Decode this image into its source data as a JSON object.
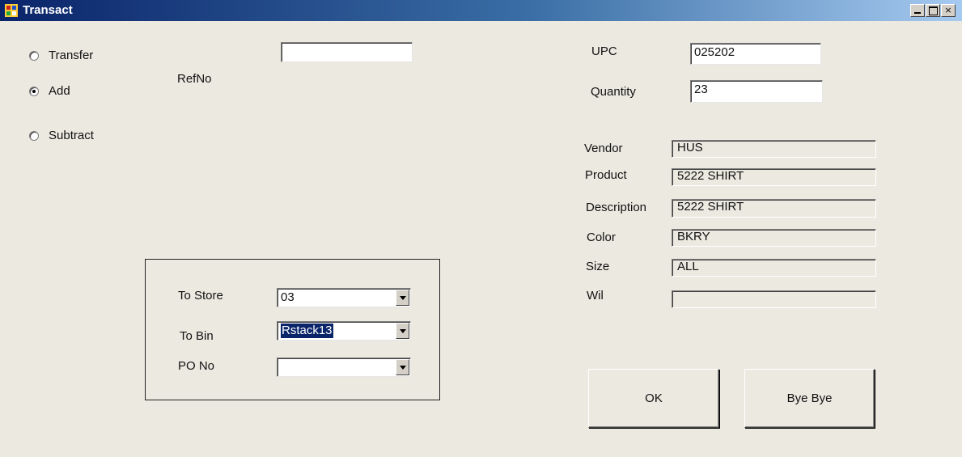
{
  "window": {
    "title": "Transact",
    "min_glyph": "",
    "max_glyph": "",
    "close_glyph": "×"
  },
  "mode": {
    "options": [
      {
        "label": "Transfer",
        "checked": false
      },
      {
        "label": "Add",
        "checked": true
      },
      {
        "label": "Subtract",
        "checked": false
      }
    ]
  },
  "refno": {
    "label": "RefNo",
    "value": ""
  },
  "upc": {
    "label": "UPC",
    "value": "025202"
  },
  "quantity": {
    "label": "Quantity",
    "value": "23"
  },
  "details": [
    {
      "label": "Vendor",
      "value": "HUS"
    },
    {
      "label": "Product",
      "value": "5222 SHIRT"
    },
    {
      "label": "Description",
      "value": "5222 SHIRT"
    },
    {
      "label": "Color",
      "value": "BKRY"
    },
    {
      "label": "Size",
      "value": "ALL"
    },
    {
      "label": "Wil",
      "value": ""
    }
  ],
  "transfer": {
    "to_store": {
      "label": "To Store",
      "value": "03"
    },
    "to_bin": {
      "label": "To Bin",
      "value": "Rstack13"
    },
    "po_no": {
      "label": "PO No",
      "value": ""
    }
  },
  "buttons": {
    "ok": "OK",
    "bye": "Bye Bye"
  },
  "colors": {
    "title_start": "#0a246a",
    "title_end": "#a6caf0",
    "face": "#ebe9e0",
    "selection": "#0a246a"
  }
}
